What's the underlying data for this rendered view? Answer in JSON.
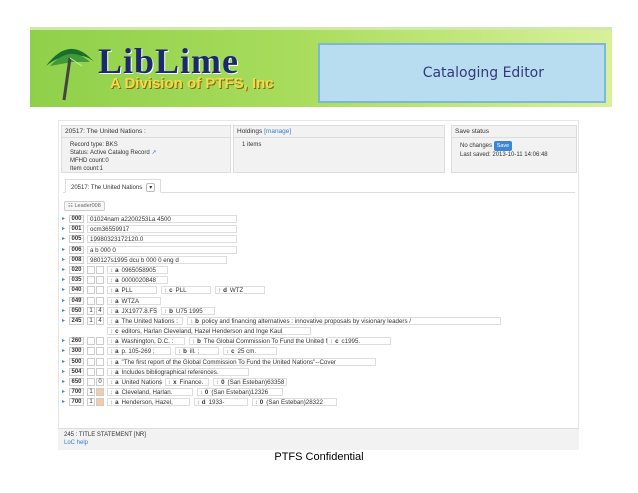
{
  "banner": {
    "logo_text": "LibLime",
    "logo_subtitle": "A Division of PTFS, Inc",
    "app_title": "Cataloging Editor"
  },
  "record_panel": {
    "heading": "20517: The United Nations :",
    "record_type": "Record type: BKS",
    "status": "Status: Active Catalog Record",
    "mfhd_count": "MFHD count:0",
    "item_count": "Item count:1"
  },
  "holdings_panel": {
    "heading": "Holdings",
    "manage_link": "[manage]",
    "items": "1 items"
  },
  "save_panel": {
    "heading": "Save status",
    "no_changes": "No changes",
    "save_button": "Save",
    "last_saved": "Last saved: 2013-10-11 14:06:48"
  },
  "tab": {
    "label": "20517: The United Nations"
  },
  "leader_button": "Leader008",
  "fields": [
    {
      "tag": "000",
      "value": "01024nam a2200253La 4500"
    },
    {
      "tag": "001",
      "value": "ocm36559917"
    },
    {
      "tag": "005",
      "value": "19980323172120.0"
    },
    {
      "tag": "006",
      "value": "a    b    000 0"
    },
    {
      "tag": "008",
      "value": "980127s1995    dcu    b    000 0 eng d"
    },
    {
      "tag": "020",
      "ind1": "",
      "ind2": "",
      "subs": [
        {
          "code": "a",
          "text": "0965058905"
        }
      ]
    },
    {
      "tag": "035",
      "ind1": "",
      "ind2": "",
      "subs": [
        {
          "code": "a",
          "text": "0000020848"
        }
      ]
    },
    {
      "tag": "040",
      "ind1": "",
      "ind2": "",
      "subs": [
        {
          "code": "a",
          "text": "PLL"
        },
        {
          "code": "c",
          "text": "PLL"
        },
        {
          "code": "d",
          "text": "WTZ"
        }
      ]
    },
    {
      "tag": "049",
      "ind1": "",
      "ind2": "",
      "subs": [
        {
          "code": "a",
          "text": "WTZA"
        }
      ]
    },
    {
      "tag": "050",
      "ind1": "1",
      "ind2": "4",
      "subs": [
        {
          "code": "a",
          "text": "JX1977.8.F5"
        },
        {
          "code": "b",
          "text": "U75 1995"
        }
      ]
    },
    {
      "tag": "245",
      "ind1": "1",
      "ind2": "4",
      "subs": [
        {
          "code": "a",
          "text": "The United Nations :"
        },
        {
          "code": "b",
          "text": "policy and financing alternatives : innovative proposals by visionary leaders /"
        }
      ]
    },
    {
      "tag": "",
      "cont": true,
      "subs": [
        {
          "code": "c",
          "text": "editors, Harlan Cleveland, Hazel Henderson and Inge Kaul"
        }
      ]
    },
    {
      "tag": "260",
      "ind1": "",
      "ind2": "",
      "subs": [
        {
          "code": "a",
          "text": "Washington, D.C. :"
        },
        {
          "code": "b",
          "text": "The Global Commission To Fund the United Nations,"
        },
        {
          "code": "c",
          "text": "c1995."
        }
      ]
    },
    {
      "tag": "300",
      "ind1": "",
      "ind2": "",
      "subs": [
        {
          "code": "a",
          "text": "p. 105-269 ;"
        },
        {
          "code": "b",
          "text": "ill. ;"
        },
        {
          "code": "c",
          "text": "25 cm."
        }
      ]
    },
    {
      "tag": "500",
      "ind1": "",
      "ind2": "",
      "subs": [
        {
          "code": "a",
          "text": "\"The first report of the Global Commission To Fund the United Nations\"--Cover"
        }
      ]
    },
    {
      "tag": "504",
      "ind1": "",
      "ind2": "",
      "subs": [
        {
          "code": "a",
          "text": "Includes bibliographical references."
        }
      ]
    },
    {
      "tag": "650",
      "ind1": "",
      "ind2": "0",
      "subs": [
        {
          "code": "a",
          "text": "United Nations"
        },
        {
          "code": "x",
          "text": "Finance."
        },
        {
          "code": "0",
          "text": "(San Esteban)63358"
        }
      ]
    },
    {
      "tag": "700",
      "ind1": "1",
      "ind2": "",
      "orange": true,
      "subs": [
        {
          "code": "a",
          "text": "Cleveland, Harlan."
        },
        {
          "code": "0",
          "text": "(San Esteban)12326"
        }
      ]
    },
    {
      "tag": "700",
      "ind1": "1",
      "ind2": "",
      "orange": true,
      "subs": [
        {
          "code": "a",
          "text": "Henderson, Hazel,"
        },
        {
          "code": "d",
          "text": "1933-"
        },
        {
          "code": "0",
          "text": "(San Esteban)28322"
        }
      ]
    }
  ],
  "status_bar": {
    "field_info": "245 : TITLE STATEMENT [NR]",
    "help_link": "LoC help"
  },
  "footer": "PTFS Confidential"
}
